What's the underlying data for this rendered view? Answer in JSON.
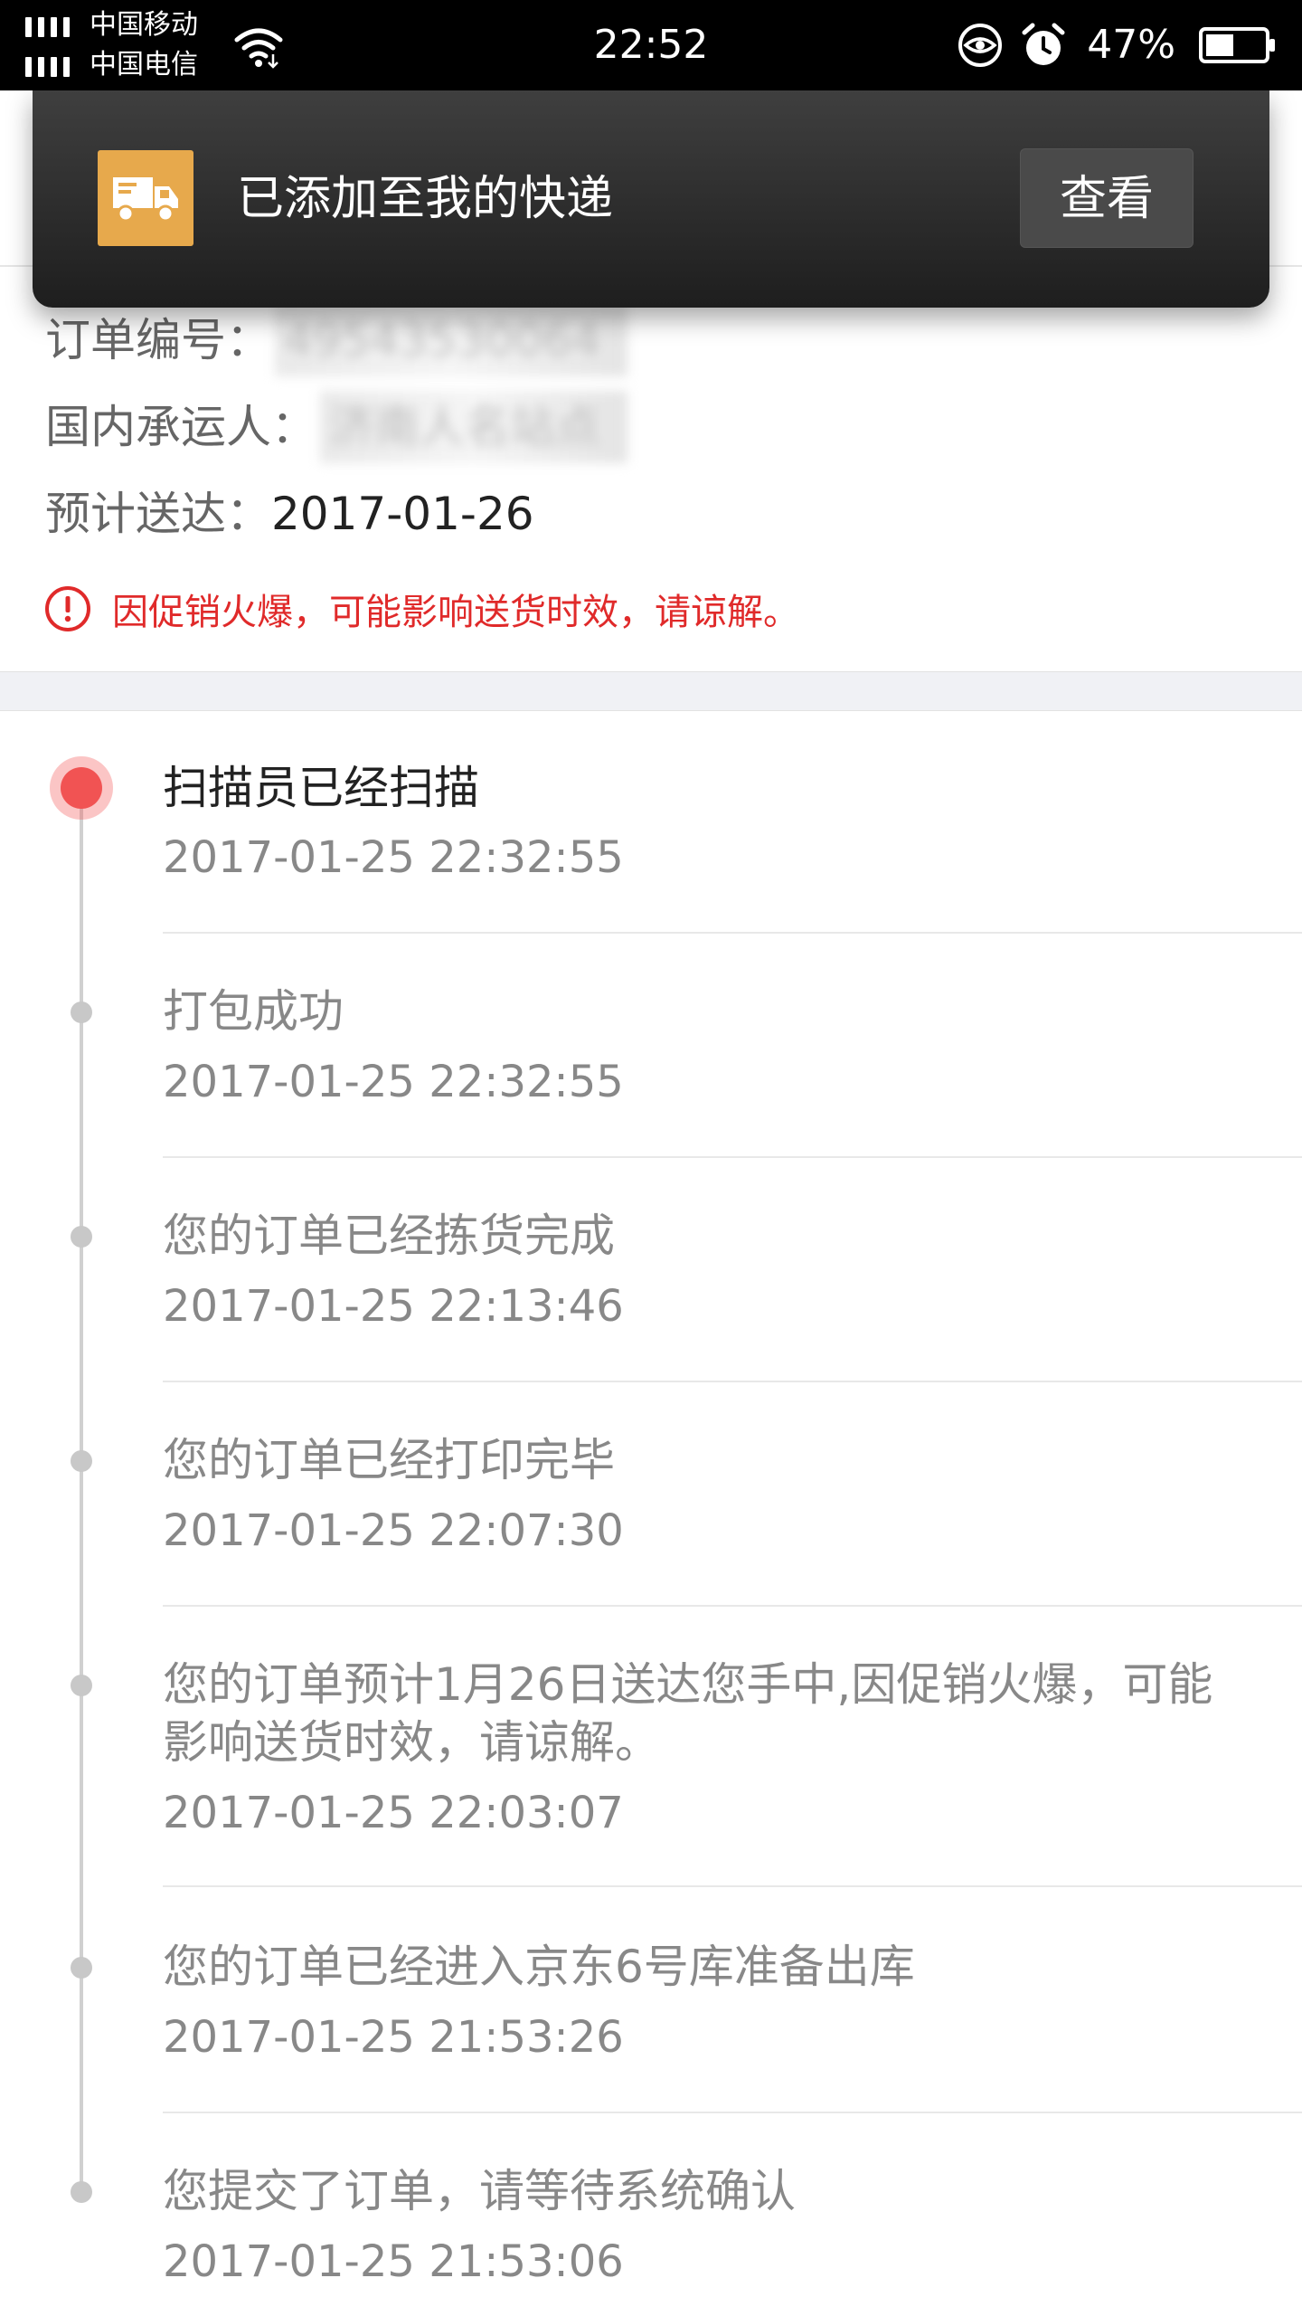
{
  "status_bar": {
    "carrier_1": "中国移动",
    "carrier_2": "中国电信",
    "time": "22:52",
    "battery": "47%",
    "icons": [
      "signal-icon",
      "wifi-icon",
      "eye-icon",
      "alarm-icon",
      "battery-icon"
    ]
  },
  "toast": {
    "icon": "delivery-truck-icon",
    "message": "已添加至我的快递",
    "button_label": "查看",
    "icon_color": "#e7a94c"
  },
  "order_info": {
    "order_no_label": "订单编号：",
    "order_no_value": "49543530064",
    "carrier_label": "国内承运人：",
    "carrier_value": "济南人名站点",
    "eta_label": "预计送达：",
    "eta_value": "2017-01-26",
    "notice": "因促销火爆，可能影响送货时效，请谅解。",
    "notice_color": "#e02a2a"
  },
  "timeline": [
    {
      "title": "扫描员已经扫描",
      "time": "2017-01-25 22:32:55"
    },
    {
      "title": "打包成功",
      "time": "2017-01-25 22:32:55"
    },
    {
      "title": "您的订单已经拣货完成",
      "time": "2017-01-25 22:13:46"
    },
    {
      "title": "您的订单已经打印完毕",
      "time": "2017-01-25 22:07:30"
    },
    {
      "title": "您的订单预计1月26日送达您手中,因促销火爆，可能影响送货时效，请谅解。",
      "time": "2017-01-25 22:03:07"
    },
    {
      "title": "您的订单已经进入京东6号库准备出库",
      "time": "2017-01-25 21:53:26"
    },
    {
      "title": "您提交了订单，请等待系统确认",
      "time": "2017-01-25 21:53:06"
    }
  ],
  "colors": {
    "active_dot": "#f15353",
    "timeline_line": "#d0d0d0"
  }
}
